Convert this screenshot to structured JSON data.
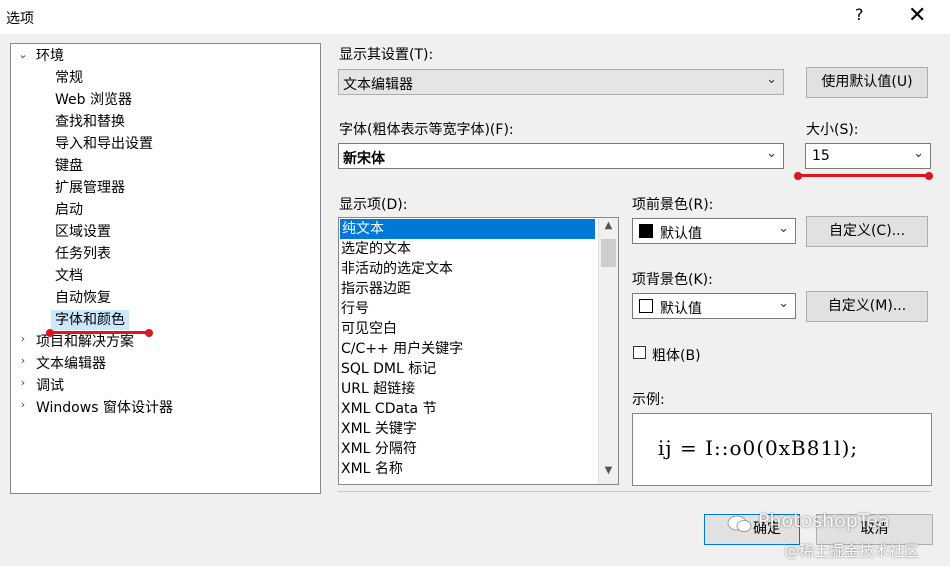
{
  "window": {
    "title": "选项",
    "help_label": "?",
    "close_label": "✕"
  },
  "tree": {
    "root": {
      "label": "环境",
      "expanded": true
    },
    "children": [
      "常规",
      "Web 浏览器",
      "查找和替换",
      "导入和导出设置",
      "键盘",
      "扩展管理器",
      "启动",
      "区域设置",
      "任务列表",
      "文档",
      "自动恢复",
      "字体和颜色"
    ],
    "selected": "字体和颜色",
    "collapsed": [
      "项目和解决方案",
      "文本编辑器",
      "调试",
      "Windows 窗体设计器"
    ]
  },
  "show_settings": {
    "label": "显示其设置(T):",
    "value": "文本编辑器"
  },
  "use_defaults_button": "使用默认值(U)",
  "font": {
    "label": "字体(粗体表示等宽字体)(F):",
    "value": "新宋体"
  },
  "size": {
    "label": "大小(S):",
    "value": "15"
  },
  "display_items": {
    "label": "显示项(D):",
    "items": [
      "纯文本",
      "选定的文本",
      "非活动的选定文本",
      "指示器边距",
      "行号",
      "可见空白",
      "C/C++ 用户关键字",
      "SQL DML 标记",
      "URL 超链接",
      "XML CData 节",
      "XML 关键字",
      "XML 分隔符",
      "XML 名称"
    ],
    "selected": "纯文本"
  },
  "foreground": {
    "label": "项前景色(R):",
    "value": "默认值",
    "swatch_color": "#000000",
    "custom_button": "自定义(C)..."
  },
  "background": {
    "label": "项背景色(K):",
    "value": "默认值",
    "swatch_color": "#ffffff",
    "custom_button": "自定义(M)..."
  },
  "bold_checkbox": {
    "label": "粗体(B)",
    "checked": false
  },
  "sample": {
    "label": "示例:",
    "text": "ij = I::o0(0xB81l);"
  },
  "ok_button": "确定",
  "cancel_button": "取消",
  "watermark": {
    "name": "PhotoshopTea",
    "site": "@稀土掘金技术社区"
  },
  "colors": {
    "selection": "#0078d7",
    "tree_selection": "#cce8ff",
    "annotation_red": "#e0141e"
  }
}
